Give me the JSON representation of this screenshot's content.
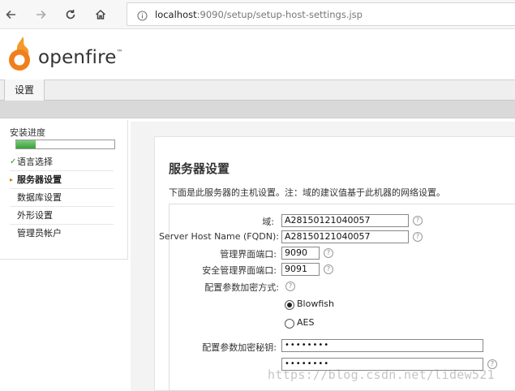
{
  "browser": {
    "url_host": "localhost",
    "url_rest": ":9090/setup/setup-host-settings.jsp",
    "icons": [
      "back-arrow-icon",
      "forward-arrow-icon",
      "reload-icon",
      "home-icon",
      "info-icon"
    ]
  },
  "header": {
    "logo_text": "openfire",
    "logo_tm": "™",
    "brand_color": "#f07f1b"
  },
  "tabs": [
    {
      "label": "设置"
    }
  ],
  "sidebar": {
    "title": "安装进度",
    "progress_percent": 20,
    "progress_color": "#3aa03a",
    "steps": [
      {
        "mark": "✓",
        "label": "语言选择",
        "state": "done"
      },
      {
        "mark": "▸",
        "label": "服务器设置",
        "state": "current"
      },
      {
        "mark": "",
        "label": "数据库设置",
        "state": "pending"
      },
      {
        "mark": "",
        "label": "外形设置",
        "state": "pending"
      },
      {
        "mark": "",
        "label": "管理员帐户",
        "state": "pending"
      }
    ]
  },
  "main": {
    "title": "服务器设置",
    "description": "下面是此服务器的主机设置。注：域的建议值基于此机器的网络设置。",
    "form": {
      "domain_label": "域:",
      "domain_value": "A28150121040057",
      "fqdn_label": "Server Host Name (FQDN):",
      "fqdn_value": "A28150121040057",
      "admin_port_label": "管理界面端口:",
      "admin_port_value": "9090",
      "secure_port_label": "安全管理界面端口:",
      "secure_port_value": "9091",
      "encryption_label": "配置参数加密方式:",
      "encryption_options": [
        {
          "label": "Blowfish",
          "selected": true
        },
        {
          "label": "AES",
          "selected": false
        }
      ],
      "key_label": "配置参数加密秘钥:",
      "key_value": "••••••••",
      "key_confirm_value": "••••••••",
      "help_glyph": "?"
    }
  },
  "watermark": "https://blog.csdn.net/lidew521"
}
